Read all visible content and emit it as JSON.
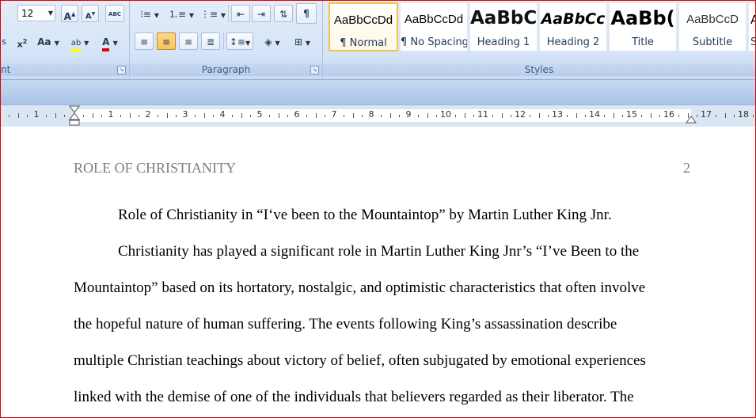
{
  "ribbon": {
    "font_size_value": "12",
    "groups": {
      "font_label": "nt",
      "paragraph_label": "Paragraph",
      "styles_label": "Styles"
    },
    "buttons": {
      "grow_font": "A",
      "shrink_font": "A",
      "clear_format": "ABC",
      "subscript": "x",
      "superscript": "x",
      "change_case": "Aa",
      "highlight": "ab",
      "font_color": "A",
      "show_marks": "¶"
    },
    "styles": [
      {
        "sample": "AaBbCcDd",
        "name": "¶ Normal"
      },
      {
        "sample": "AaBbCcDd",
        "name": "¶ No Spacing"
      },
      {
        "sample": "AaBbC",
        "name": "Heading 1"
      },
      {
        "sample": "AaBbCc",
        "name": "Heading 2"
      },
      {
        "sample": "AaBb(",
        "name": "Title"
      },
      {
        "sample": "AaBbCcD",
        "name": "Subtitle"
      },
      {
        "sample": "A",
        "name": "S"
      }
    ],
    "colors": {
      "highlight": "#ffff00",
      "font_color": "#e00000",
      "selected_style_border": "#f5c146"
    }
  },
  "ruler": {
    "numbers": [
      "1",
      "1",
      "2",
      "3",
      "4",
      "5",
      "6",
      "7",
      "8",
      "9",
      "10",
      "11",
      "12",
      "13",
      "14",
      "15",
      "16",
      "17",
      "18"
    ]
  },
  "document": {
    "header_text": "ROLE OF CHRISTIANITY",
    "page_number": "2",
    "title": "Role of Christianity in “I‘ve been to the Mountaintop” by Martin Luther King Jnr.",
    "lines": [
      " Christianity has played a significant role in Martin Luther King Jnr’s “I’ve Been to the",
      "Mountaintop” based on its hortatory, nostalgic, and optimistic characteristics that often involve",
      "the hopeful nature of human suffering. The events following King’s assassination describe",
      "multiple Christian teachings about victory of belief, often subjugated by emotional experiences",
      "linked with the demise of one of the individuals that believers regarded as their liberator. The"
    ]
  }
}
